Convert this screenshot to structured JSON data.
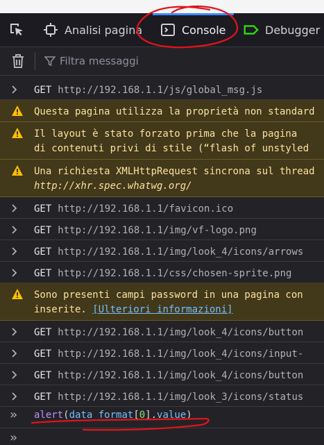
{
  "toolbar": {
    "inspector_label": "Analisi pagina",
    "console_label": "Console",
    "debugger_label": "Debugger"
  },
  "filter": {
    "placeholder": "Filtra messaggi"
  },
  "messages": [
    {
      "method": "GET",
      "url": "http://192.168.1.1/js/global_msg.js"
    },
    {
      "text": "Questa pagina utilizza la proprietà non standard"
    },
    {
      "line1": "Il layout è stato forzato prima che la pagina",
      "line2": "di contenuti privi di stile (“flash of unstyled"
    },
    {
      "line1": "Una richiesta XMLHttpRequest sincrona sul thread",
      "line2": "http://xhr.spec.whatwg.org/"
    },
    {
      "method": "GET",
      "url": "http://192.168.1.1/favicon.ico"
    },
    {
      "method": "GET",
      "url": "http://192.168.1.1/img/vf-logo.png"
    },
    {
      "method": "GET",
      "url": "http://192.168.1.1/img/look_4/icons/arrows"
    },
    {
      "method": "GET",
      "url": "http://192.168.1.1/css/chosen-sprite.png"
    },
    {
      "line1": "Sono presenti campi password in una pagina con",
      "line2_text": "inserite.",
      "link": "[Ulteriori informazioni]"
    },
    {
      "method": "GET",
      "url": "http://192.168.1.1/img/look_4/icons/button"
    },
    {
      "method": "GET",
      "url": "http://192.168.1.1/img/look_4/icons/input-"
    },
    {
      "method": "GET",
      "url": "http://192.168.1.1/img/look_4/icons/button"
    },
    {
      "method": "GET",
      "url": "http://192.168.1.1/img/look_3/icons/status"
    }
  ],
  "input": {
    "prompt": "»",
    "fn": "alert",
    "open": "(",
    "var": "data_format",
    "lb": "[",
    "index": "0",
    "rb": "].",
    "prop": "value",
    "close": ")"
  },
  "bottom_prompt": "»",
  "colors": {
    "accent": "#3b8bff",
    "warning_bg": "#42381a",
    "annotation": "#e0141b"
  }
}
